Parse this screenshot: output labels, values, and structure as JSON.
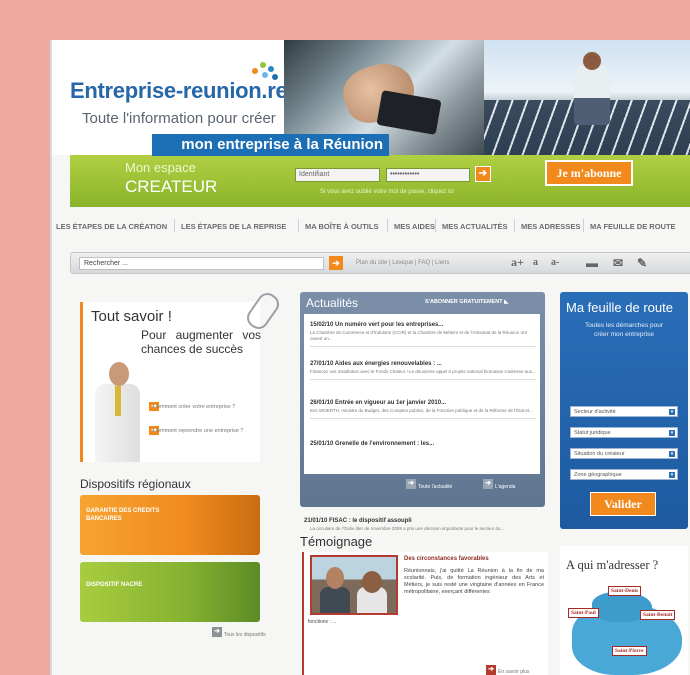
{
  "header": {
    "logo": "Entreprise-reunion.re",
    "tagline_1": "Toute l'information pour créer",
    "tagline_2": "mon entreprise à la Réunion"
  },
  "login": {
    "space_label_1": "Mon espace",
    "space_label_2": "CREATEUR",
    "id_placeholder": "Identifiant",
    "password_value": "••••••••••••",
    "go_icon": "arrow-right-icon",
    "help_text": "Si vous avez oublié votre mot de passe, cliquez ici",
    "subscribe_label": "Je m'abonne"
  },
  "nav": {
    "items": [
      "LES ÉTAPES DE LA CRÉATION",
      "LES ÉTAPES DE LA REPRISE",
      "MA BOÎTE À OUTILS",
      "MES AIDES",
      "MES ACTUALITÉS",
      "MES ADRESSES",
      "MA FEUILLE DE ROUTE"
    ]
  },
  "search": {
    "placeholder": "Rechercher ...",
    "links": "Plan du site  |  Lexique  |  FAQ  |  Liens",
    "tools": [
      "a+",
      "a",
      "a-"
    ]
  },
  "tout_savoir": {
    "title": "Tout savoir !",
    "line_1": "Pour augmenter vos",
    "line_2": "chances de succès",
    "link_1": "Comment créer votre entreprise ?",
    "link_2": "Comment reprendre une entreprise ?"
  },
  "dispositifs": {
    "title": "Dispositifs régionaux",
    "item_1": "GARANTIE DES CREDITS BANCAIRES",
    "item_2": "DISPOSITIF NACRE",
    "all_link": "Tous les dispositifs"
  },
  "actualites": {
    "title": "Actualités",
    "subscribe": "S'ABONNER GRATUITEMENT",
    "items": [
      {
        "title": "15/02/10  Un numéro vert pour les entreprises...",
        "desc": "La Chambre de Commerce et d'Industrie (CCIR) et la Chambre de Métiers et de l'Artisanat de la Réunion ont ouvert un..."
      },
      {
        "title": "27/01/10  Aides aux énergies renouvelables : ...",
        "desc": "Financez vos installation avec le Fonds Chaleur ! Le deuxième appel à projets national biomasse s'adresse aux..."
      },
      {
        "title": "26/01/10  Entrée en vigueur au 1er janvier 2010...",
        "desc": "Eric WOERTH, ministre du Budget, des Comptes publics, de la Fonction publique et de la Réforme de l'État et..."
      },
      {
        "title": "25/01/10  Grenelle de l'environnement : les...",
        "desc": ""
      }
    ],
    "all_link": "Toute l'actualité",
    "agenda_link": "L'agenda"
  },
  "fisac": {
    "title": "21/01/10  FISAC : le dispositif assoupli",
    "desc": "La circulaire de l'Ouhe liter de novembre 2009 a pris une décision importante pour le secteur du..."
  },
  "temoignage": {
    "title": "Témoignage",
    "headline": "Des circonstances favorables",
    "quote": "Réunionnais, j'ai quitté La Réunion à la fin de ma scolarité. Puis, de formation ingénieur des Arts et Métiers, je suis resté une vingtaine d'années en France métropolitaine, exerçant différentes",
    "continued": "fonctions : ...",
    "more_link": "En savoir plus"
  },
  "feuille_de_route": {
    "title": "Ma feuille de route",
    "subtitle_1": "Toutes les démarches pour",
    "subtitle_2": "créer mon entreprise",
    "selects": [
      "Secteur d'activité",
      "Statut juridique",
      "Situation du créateur",
      "Zone géographique"
    ],
    "submit": "Valider"
  },
  "qui": {
    "title": "A qui m'adresser ?",
    "places": [
      "Saint-Denis",
      "Saint-Paul",
      "Saint-Benoît",
      "Saint-Pierre"
    ]
  },
  "colors": {
    "accent": "#f2891c",
    "brand_blue": "#1d6fb5",
    "green": "#9cc135",
    "background": "#efa9a0"
  }
}
